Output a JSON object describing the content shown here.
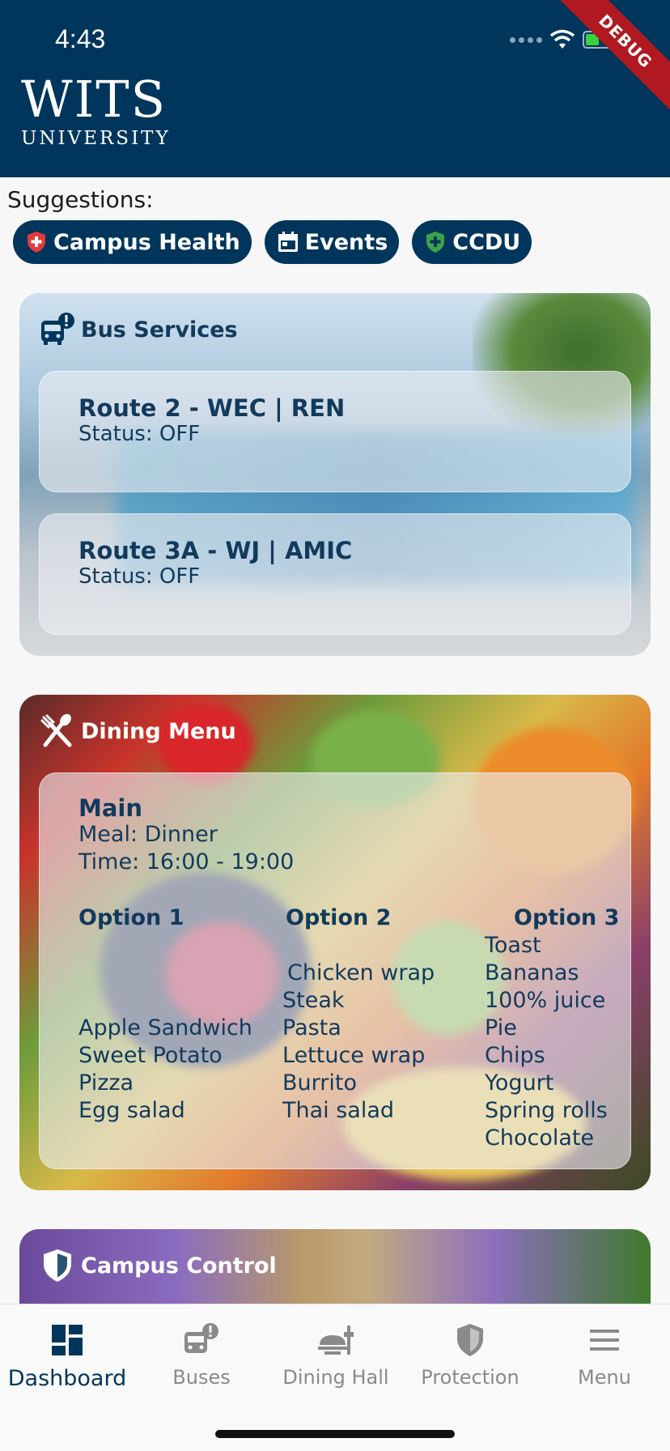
{
  "status_bar": {
    "time": "4:43",
    "debug_label": "DEBUG"
  },
  "header": {
    "logo_main": "WITS",
    "logo_sub": "UNIVERSITY"
  },
  "suggestions": {
    "label": "Suggestions:",
    "chips": [
      {
        "label": "Campus Health",
        "icon": "health-shield-icon"
      },
      {
        "label": "Events",
        "icon": "calendar-icon"
      },
      {
        "label": "CCDU",
        "icon": "shield-plus-icon"
      }
    ]
  },
  "bus_services": {
    "title": "Bus Services",
    "routes": [
      {
        "name": "Route 2 - WEC | REN",
        "status": "Status: OFF"
      },
      {
        "name": "Route 3A - WJ | AMIC",
        "status": "Status: OFF"
      }
    ]
  },
  "dining_menu": {
    "title": "Dining Menu",
    "section": "Main",
    "meal": "Meal: Dinner",
    "time": "Time: 16:00 - 19:00",
    "options": [
      {
        "header": "Option 1",
        "items": [
          "Apple Sandwich",
          "Sweet Potato",
          "Pizza",
          "Egg salad"
        ]
      },
      {
        "header": "Option 2",
        "items": [
          "Chicken wrap",
          "Steak",
          "Pasta",
          "Lettuce wrap",
          "Burrito",
          "Thai salad"
        ]
      },
      {
        "header": "Option 3",
        "items": [
          "Toast",
          "Bananas",
          "100% juice",
          "Pie",
          "Chips",
          "Yogurt",
          "Spring rolls",
          "Chocolate"
        ]
      }
    ]
  },
  "campus_control": {
    "title": "Campus Control"
  },
  "bottom_nav": {
    "items": [
      {
        "label": "Dashboard",
        "active": true
      },
      {
        "label": "Buses",
        "active": false
      },
      {
        "label": "Dining Hall",
        "active": false
      },
      {
        "label": "Protection",
        "active": false
      },
      {
        "label": "Menu",
        "active": false
      }
    ]
  },
  "colors": {
    "primary": "#01365c",
    "inactive": "#8a8a8a",
    "debug": "#b0191f"
  }
}
